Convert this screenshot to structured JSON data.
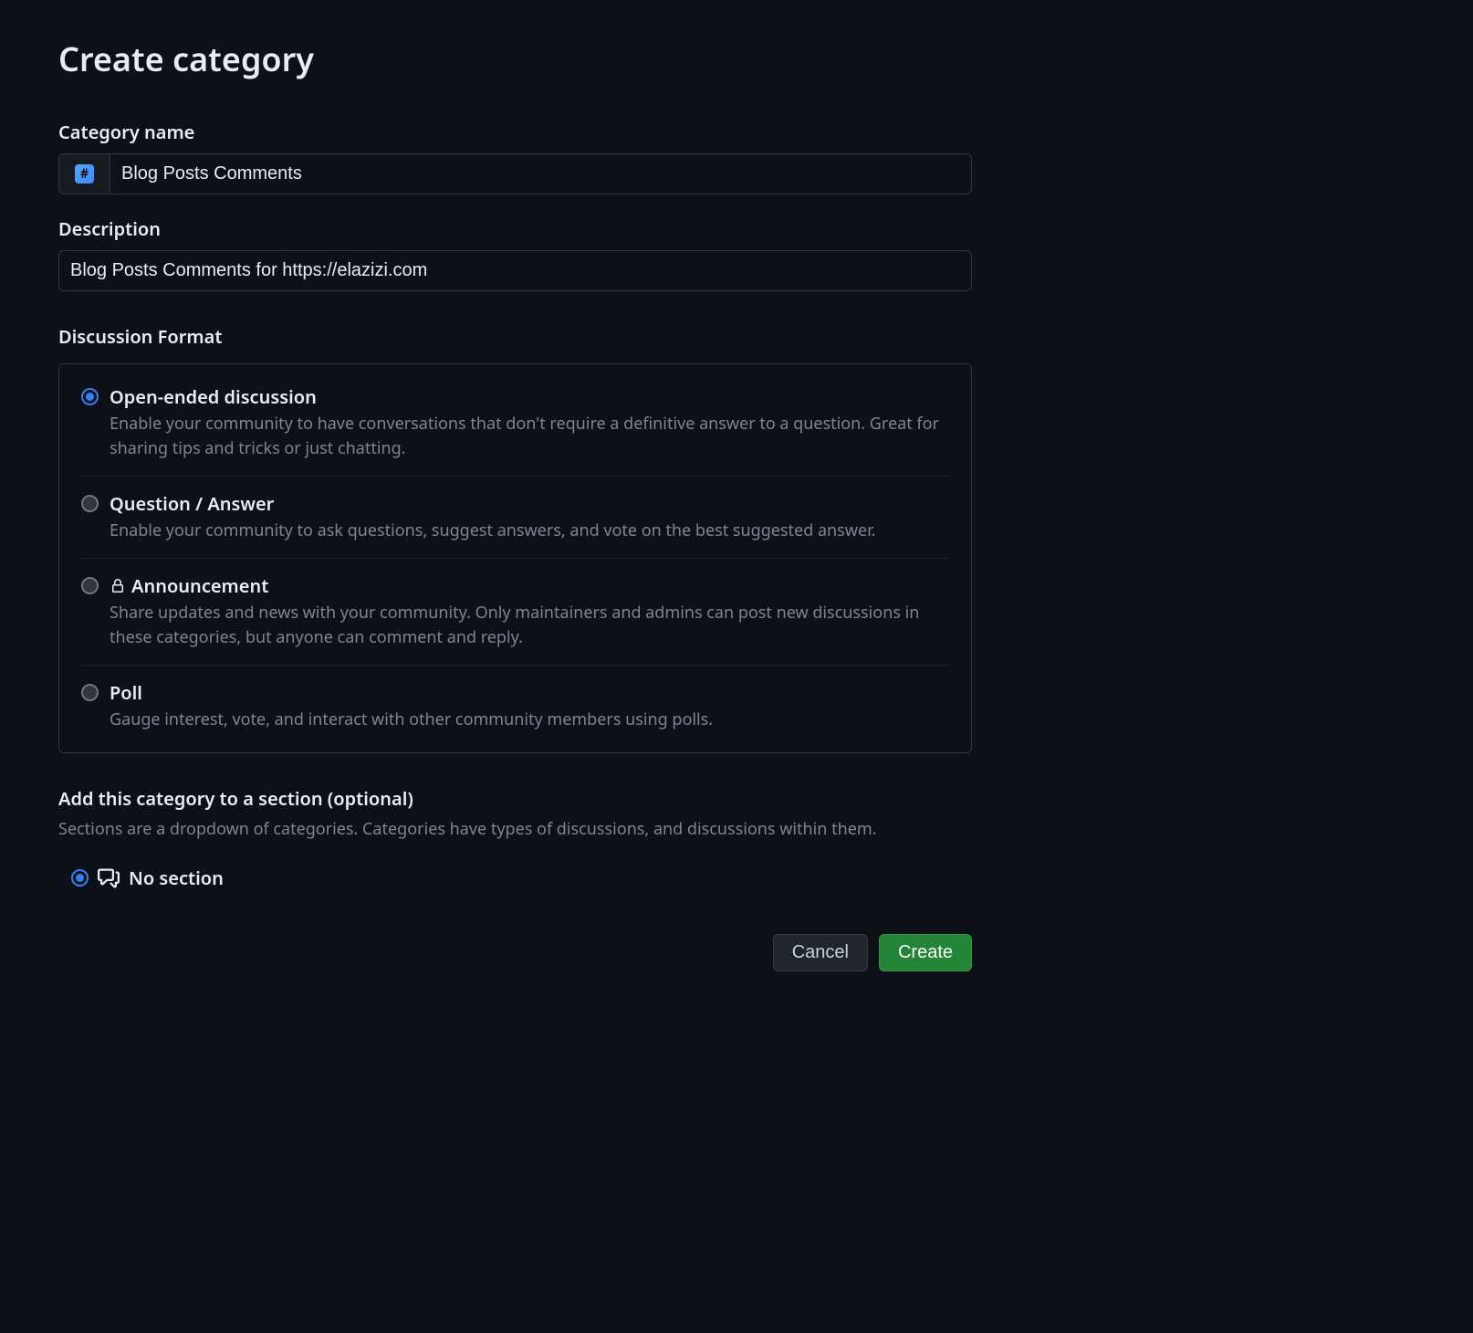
{
  "page_title": "Create category",
  "category_name": {
    "label": "Category name",
    "value": "Blog Posts Comments",
    "emoji_char": "#"
  },
  "description": {
    "label": "Description",
    "value": "Blog Posts Comments for https://elazizi.com"
  },
  "discussion_format": {
    "heading": "Discussion Format",
    "options": [
      {
        "title": "Open-ended discussion",
        "desc": "Enable your community to have conversations that don't require a definitive answer to a question. Great for sharing tips and tricks or just chatting.",
        "selected": true,
        "has_lock": false
      },
      {
        "title": "Question / Answer",
        "desc": "Enable your community to ask questions, suggest answers, and vote on the best suggested answer.",
        "selected": false,
        "has_lock": false
      },
      {
        "title": "Announcement",
        "desc": "Share updates and news with your community. Only maintainers and admins can post new discussions in these categories, but anyone can comment and reply.",
        "selected": false,
        "has_lock": true
      },
      {
        "title": "Poll",
        "desc": "Gauge interest, vote, and interact with other community members using polls.",
        "selected": false,
        "has_lock": false
      }
    ]
  },
  "section": {
    "heading": "Add this category to a section (optional)",
    "sub": "Sections are a dropdown of categories. Categories have types of discussions, and discussions within them.",
    "options": [
      {
        "label": "No section",
        "selected": true
      }
    ]
  },
  "footer": {
    "cancel": "Cancel",
    "create": "Create"
  }
}
